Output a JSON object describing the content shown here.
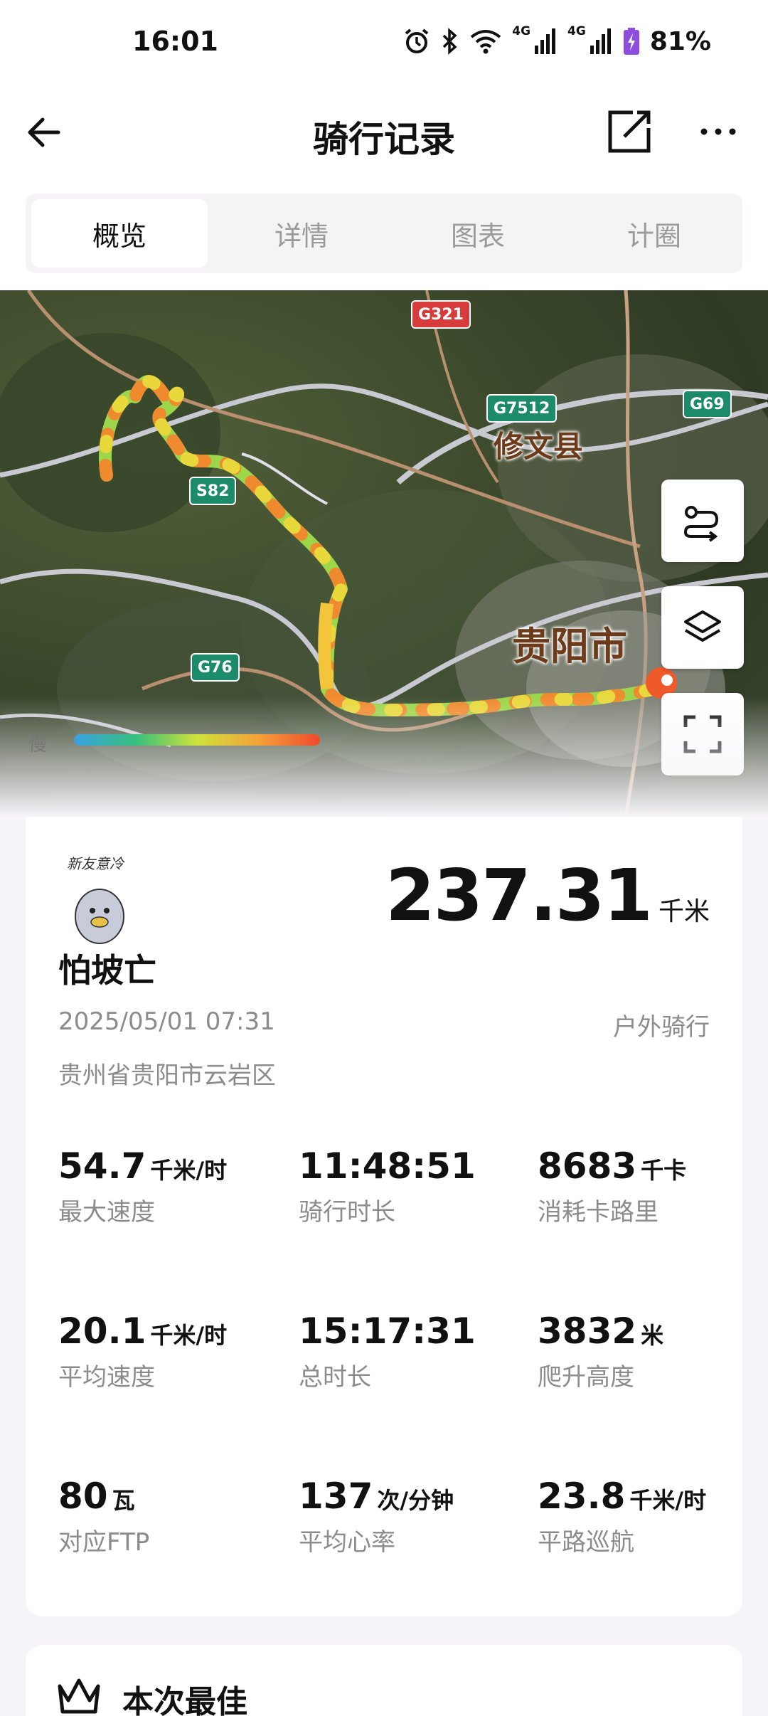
{
  "status_bar": {
    "time": "16:01",
    "network_1": "4G",
    "network_2": "4G",
    "battery": "81%"
  },
  "header": {
    "title": "骑行记录",
    "back_icon": "arrow-left-icon",
    "edit_icon": "edit-share-icon",
    "more_icon": "more-dots-icon"
  },
  "tabs": [
    {
      "label": "概览",
      "active": true
    },
    {
      "label": "详情",
      "active": false
    },
    {
      "label": "图表",
      "active": false
    },
    {
      "label": "计圈",
      "active": false
    }
  ],
  "map": {
    "road_badges": [
      "G321",
      "G7512",
      "G69",
      "S82",
      "G76"
    ],
    "places": [
      "修文县",
      "贵阳市"
    ],
    "legend_label": "慢",
    "controls": [
      "route-icon",
      "layers-icon",
      "fullscreen-icon"
    ]
  },
  "summary": {
    "avatar_caption": "新友意冷",
    "distance": "237.31",
    "distance_unit": "千米",
    "username": "怕坡亡",
    "datetime": "2025/05/01 07:31",
    "activity_type": "户外骑行",
    "location": "贵州省贵阳市云岩区",
    "stats": [
      {
        "value": "54.7",
        "unit": "千米/时",
        "label": "最大速度"
      },
      {
        "value": "11:48:51",
        "unit": "",
        "label": "骑行时长"
      },
      {
        "value": "8683",
        "unit": "千卡",
        "label": "消耗卡路里"
      },
      {
        "value": "20.1",
        "unit": "千米/时",
        "label": "平均速度"
      },
      {
        "value": "15:17:31",
        "unit": "",
        "label": "总时长"
      },
      {
        "value": "3832",
        "unit": "米",
        "label": "爬升高度"
      },
      {
        "value": "80",
        "unit": "瓦",
        "label": "对应FTP"
      },
      {
        "value": "137",
        "unit": "次/分钟",
        "label": "平均心率"
      },
      {
        "value": "23.8",
        "unit": "千米/时",
        "label": "平路巡航"
      }
    ]
  },
  "best": {
    "title": "本次最佳"
  }
}
